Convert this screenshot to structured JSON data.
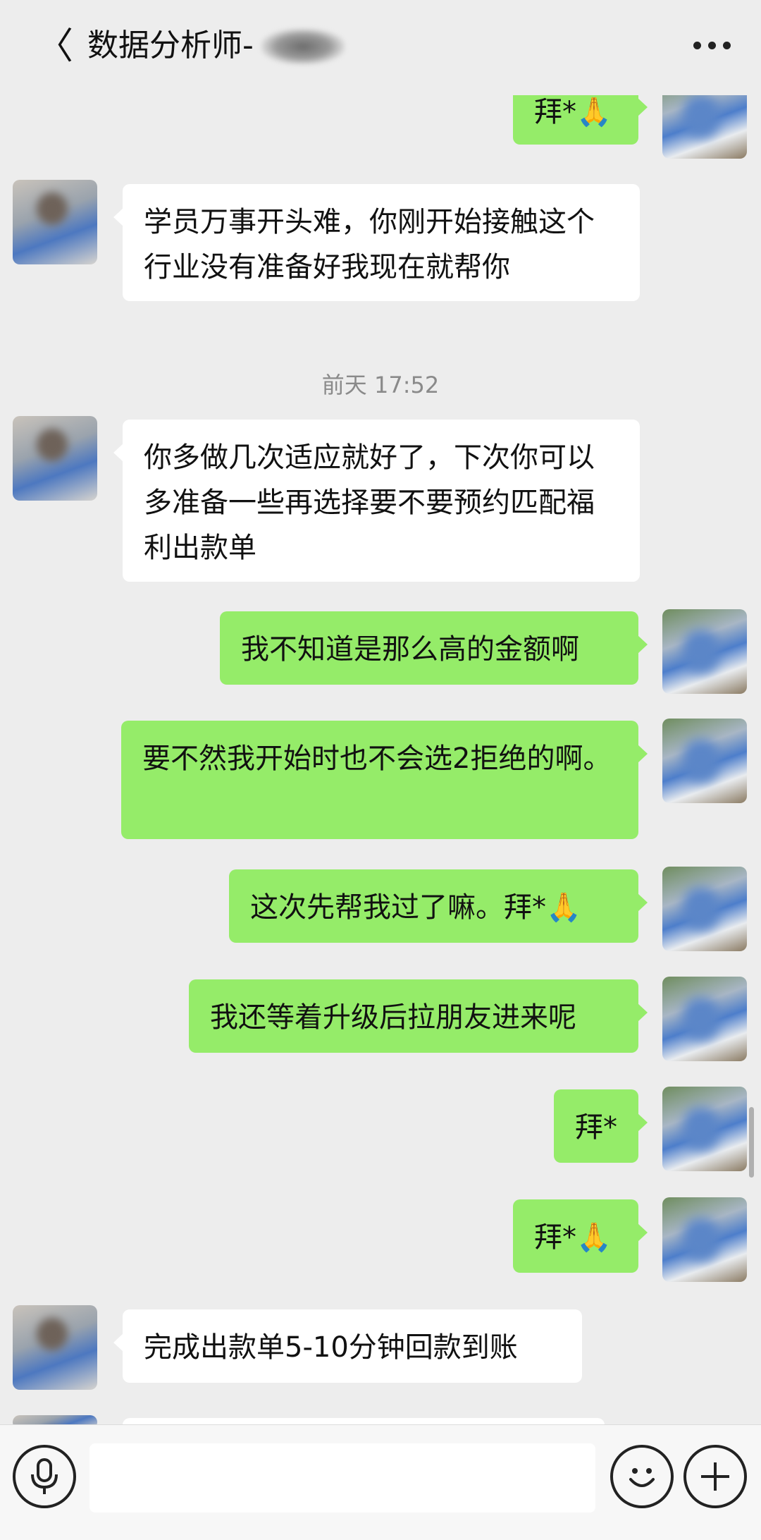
{
  "header": {
    "back_label": "〈",
    "title": "数据分析师-"
  },
  "messages": [
    {
      "side": "right",
      "text": "拜*🙏"
    },
    {
      "side": "left",
      "text": "学员万事开头难，你刚开始接触这个行业没有准备好我现在就帮你"
    },
    {
      "timestamp": "前天 17:52"
    },
    {
      "side": "left",
      "text": "你多做几次适应就好了，下次你可以多准备一些再选择要不要预约匹配福利出款单"
    },
    {
      "side": "right",
      "text": "我不知道是那么高的金额啊"
    },
    {
      "side": "right",
      "text": "要不然我开始时也不会选2拒绝的啊。"
    },
    {
      "side": "right",
      "text": "这次先帮我过了嘛。拜*🙏"
    },
    {
      "side": "right",
      "text": "我还等着升级后拉朋友进来呢"
    },
    {
      "side": "right",
      "text": "拜*"
    },
    {
      "side": "right",
      "text": "拜*🙏"
    },
    {
      "side": "left",
      "text": "完成出款单5-10分钟回款到账"
    }
  ],
  "input": {
    "value": "",
    "voice_icon": "microphone-icon",
    "emoji_icon": "smiley-icon",
    "plus_icon": "plus-icon"
  },
  "colors": {
    "background": "#ededed",
    "bubble_self": "#95ec69",
    "bubble_other": "#ffffff",
    "timestamp": "#8a8a8a"
  }
}
